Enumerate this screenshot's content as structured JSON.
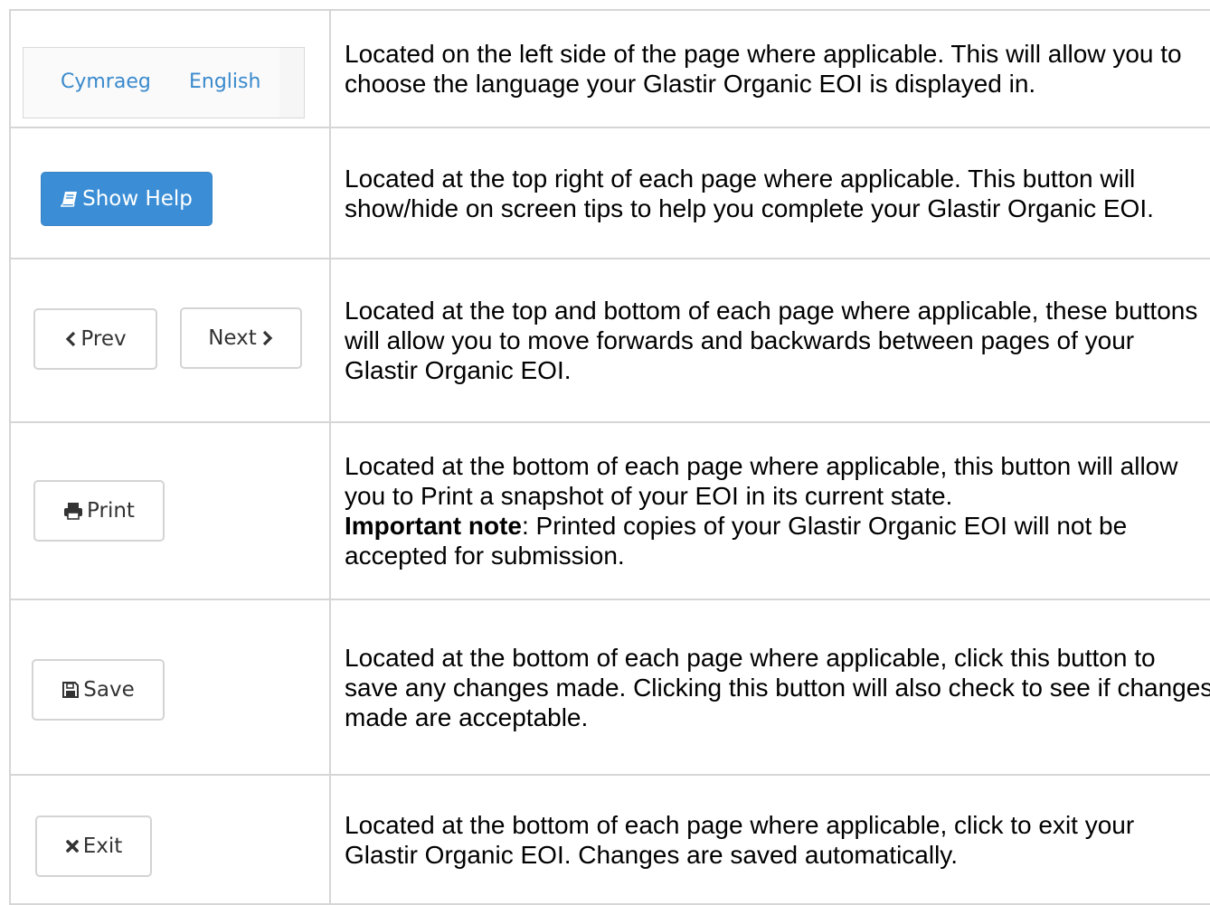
{
  "rows": [
    {
      "widget": {
        "cymraeg": "Cymraeg",
        "english": "English"
      },
      "description": "Located on the left side of the page where applicable. This will allow you to choose the language your Glastir Organic EOI is displayed in."
    },
    {
      "widget": {
        "label": "Show Help",
        "icon": "book-icon"
      },
      "description": "Located at the top right of each page where applicable. This button will show/hide on screen tips to help you complete your Glastir Organic EOI."
    },
    {
      "widget": {
        "prev_label": "Prev",
        "next_label": "Next",
        "prev_icon": "chevron-left-icon",
        "next_icon": "chevron-right-icon"
      },
      "description": "Located at the top and bottom of each page where applicable, these buttons will allow you to move forwards and backwards between pages of your Glastir Organic EOI."
    },
    {
      "widget": {
        "label": "Print",
        "icon": "print-icon"
      },
      "description": "Located at the bottom of each page where applicable, this button will allow you to Print a snapshot of your EOI in its current state.",
      "note_label": "Important note",
      "note_text": ": Printed copies of your Glastir Organic EOI will not be accepted for submission."
    },
    {
      "widget": {
        "label": "Save",
        "icon": "floppy-disk-icon"
      },
      "description": "Located at the bottom of each page where applicable, click this button to save any changes made. Clicking this button will also check to see if changes made are acceptable."
    },
    {
      "widget": {
        "label": "Exit",
        "icon": "close-icon"
      },
      "description": "Located at the bottom of each page where applicable, click to exit your Glastir Organic EOI. Changes are saved automatically."
    }
  ],
  "colors": {
    "primary_button": "#3b8ed6",
    "link": "#3a8acd",
    "border": "#d6d6d6"
  }
}
